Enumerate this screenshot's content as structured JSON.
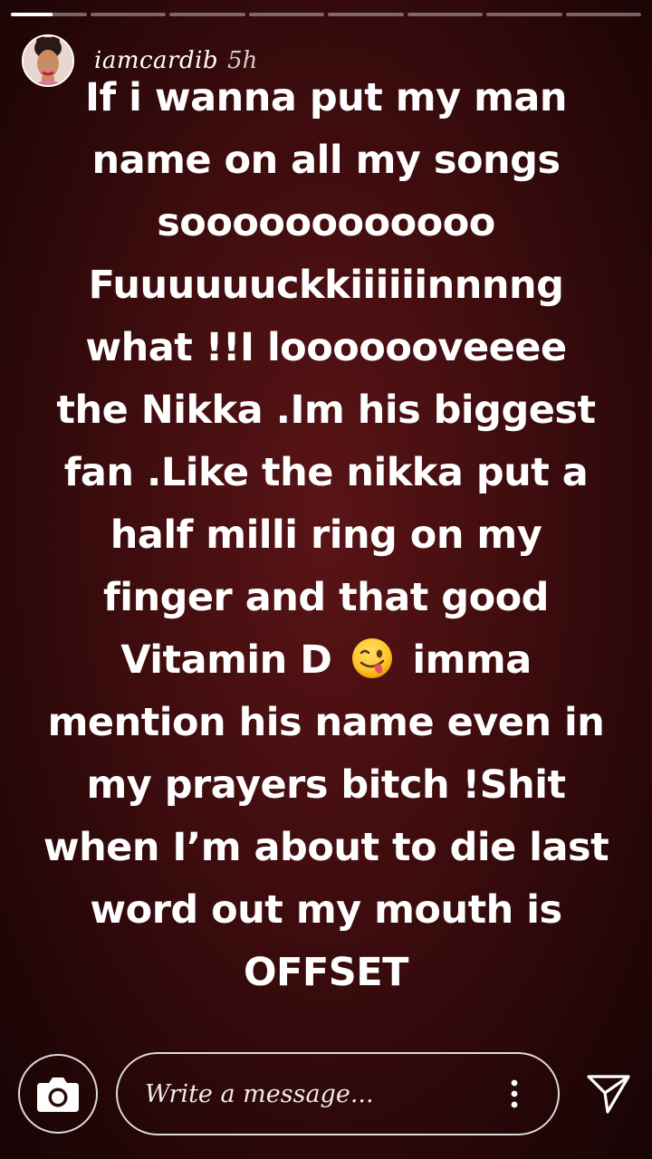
{
  "story": {
    "segment_count": 8,
    "active_segment_progress": 0.55,
    "user": {
      "username": "iamcardib",
      "time_ago": "5h",
      "avatar_icon": "profile-photo"
    },
    "message_lines": [
      "If i wanna put my man",
      "name on all my songs",
      "soooooooooooo",
      "Fuuuuuuckkiiiiiinnnng",
      "what !!I looooooveeee",
      "the Nikka .Im his biggest",
      "fan .Like the nikka put a",
      "half milli ring on my",
      "finger and that good",
      "Vitamin D",
      "imma",
      "mention his name even in",
      "my prayers bitch !Shit",
      "when I’m about to die last",
      "word out my mouth is",
      "OFFSET"
    ],
    "emoji_icon": "winking-face-with-tongue"
  },
  "composer": {
    "placeholder": "Write a message...",
    "camera_icon": "camera-icon",
    "more_icon": "more-vertical-icon",
    "send_icon": "send-icon"
  },
  "colors": {
    "background": "#3d0c0e",
    "text": "#ffffff"
  }
}
